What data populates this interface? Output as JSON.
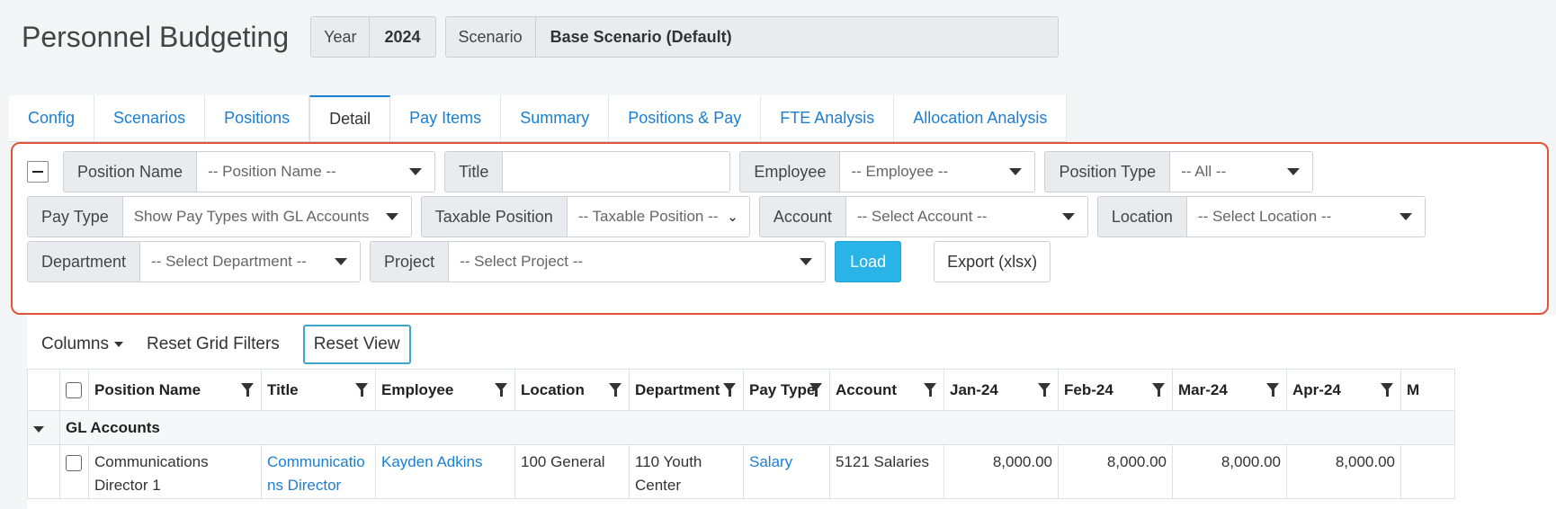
{
  "header": {
    "title": "Personnel Budgeting",
    "year_label": "Year",
    "year_value": "2024",
    "scenario_label": "Scenario",
    "scenario_value": "Base Scenario (Default)"
  },
  "tabs": [
    {
      "label": "Config"
    },
    {
      "label": "Scenarios"
    },
    {
      "label": "Positions"
    },
    {
      "label": "Detail",
      "active": true
    },
    {
      "label": "Pay Items"
    },
    {
      "label": "Summary"
    },
    {
      "label": "Positions & Pay"
    },
    {
      "label": "FTE Analysis"
    },
    {
      "label": "Allocation Analysis"
    }
  ],
  "filters": {
    "position_name": {
      "label": "Position Name",
      "value": "-- Position Name --"
    },
    "title": {
      "label": "Title",
      "value": ""
    },
    "employee": {
      "label": "Employee",
      "value": "-- Employee --"
    },
    "position_type": {
      "label": "Position Type",
      "value": "-- All --"
    },
    "pay_type": {
      "label": "Pay Type",
      "value": "Show Pay Types with GL Accounts"
    },
    "taxable_position": {
      "label": "Taxable Position",
      "value": "-- Taxable Position --"
    },
    "account": {
      "label": "Account",
      "value": "-- Select Account --"
    },
    "location": {
      "label": "Location",
      "value": "-- Select Location --"
    },
    "department": {
      "label": "Department",
      "value": "-- Select Department --"
    },
    "project": {
      "label": "Project",
      "value": "-- Select Project --"
    },
    "load_label": "Load",
    "export_label": "Export (xlsx)"
  },
  "toolbar": {
    "columns_label": "Columns",
    "reset_filters_label": "Reset Grid Filters",
    "reset_view_label": "Reset View"
  },
  "grid": {
    "headers": [
      "Position Name",
      "Title",
      "Employee",
      "Location",
      "Department",
      "Pay Type",
      "Account",
      "Jan-24",
      "Feb-24",
      "Mar-24",
      "Apr-24",
      "M"
    ],
    "group_label": "GL Accounts",
    "rows": [
      {
        "position_name": "Communications Director 1",
        "title": "Communications Director",
        "employee": "Kayden Adkins",
        "location": "100 General",
        "department": "110 Youth Center",
        "pay_type": "Salary",
        "account": "5121 Salaries",
        "jan": "8,000.00",
        "feb": "8,000.00",
        "mar": "8,000.00",
        "apr": "8,000.00"
      }
    ]
  },
  "colors": {
    "accent": "#1b7fd1",
    "load_button": "#29b3e6",
    "highlight_border": "#e0533a"
  }
}
